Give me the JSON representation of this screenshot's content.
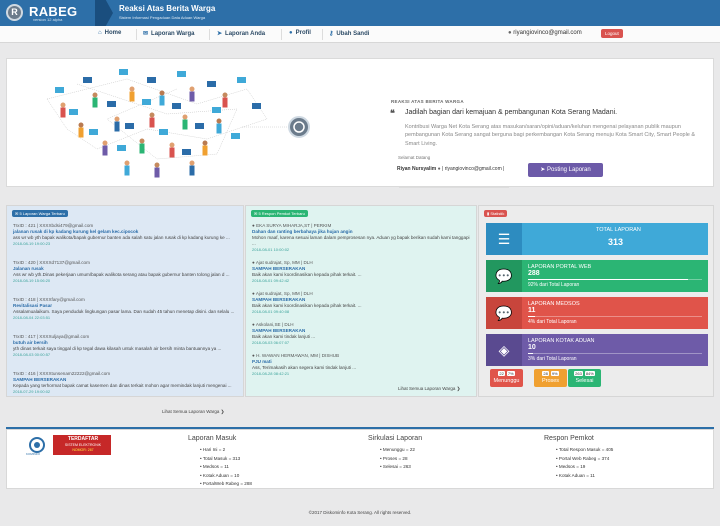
{
  "header": {
    "logo_letter": "R",
    "logo_text": "RABEG",
    "logo_sub": "version 12 alpha",
    "app_title": "Reaksi Atas Berita Warga",
    "app_subtitle": "Sistem Informasi Pengaduan Data Aduan Warga",
    "accent_color": "#2d6fa8"
  },
  "nav": {
    "items": [
      {
        "icon": "home-icon",
        "label": "Home"
      },
      {
        "icon": "comments-icon",
        "label": "Laporan Warga"
      },
      {
        "icon": "send-icon",
        "label": "Laporan Anda"
      },
      {
        "icon": "user-icon",
        "label": "Profil"
      },
      {
        "icon": "key-icon",
        "label": "Ubah Sandi"
      }
    ],
    "user_email": "riyangiovinco@gmail.com",
    "logout_label": "Logout"
  },
  "hero": {
    "tag": "REAKSI ATAS BERITA WARGA",
    "quote": "Jadilah bagian dari kemajuan & pembangunan Kota Serang Madani.",
    "description": "Kontribusi Warga Net Kota Serang atas masukan/saran/opini/aduan/keluhan mengenai pelayanan publik maupun pembangunan Kota Serang sangat berguna bagi perkembangan Kota Serang menuju Kota Smart City, Smart People & Smart Living.",
    "welcome": "Selamat Datang",
    "user_name": "Riyan Nursyalim",
    "user_email_line": "| riyangiovinco@gmail.com |",
    "post_button": "Posting Laporan"
  },
  "panel_warga": {
    "label": "5 Laporan Warga Terbaru",
    "items": [
      {
        "head": "TrxID : 421 | XXXXbdsi479@gmail.com",
        "title": "jalanan rusak di kp kadang kurung kel gelam kec.cipocok",
        "body": "ass wr wb yth bapak walikota/bapak gubernur banten ada salah satu jalan rusak di kp kadang kurung ke ...",
        "date": "2018-08-19 19:00:23"
      },
      {
        "head": "TrxID : 420 | XXXXd7137@gmail.com",
        "title": "Jalanan rusak",
        "body": "Ass wr wb yth.Dinas pekerjaan umum/bapak walikota serang atau bapak gubernur banten tolong jalan d ...",
        "date": "2018-08-19 15:06:20"
      },
      {
        "head": "TrxID : 418 | XXXXfary@gmail.com",
        "title": "Revitalisasi Pasar",
        "body": "Assalamualaikum. Saya penduduk lingkungan pasar lama. Dan sudah 45 tahun menetap disini. dan selalu ...",
        "date": "2018-08-04 22:03:51"
      },
      {
        "head": "TrxID : 417 | XXXXuljaya@gmail.com",
        "title": "butuh air bersih",
        "body": "yth dinas terkait saya tinggal di kp tegal dawa kilasah untuk masalah air bersih minta bantuannya ya ...",
        "date": "2018-08-03 00:00:57"
      },
      {
        "head": "TrxID : 416 | XXXXtunsenam22222@gmail.com",
        "title": "SAMPAH BERSERAKAN",
        "body": "Kepada yang terhormat bapak camat kasemen dan dinas terkait mohon agar memindak lanjuti mengenai ...",
        "date": "2018-07-29 19:00:02"
      }
    ],
    "more": "Lihat Semua Laporan Warga"
  },
  "panel_respon": {
    "label": "5 Respon Pemkot Terbaru",
    "items": [
      {
        "head": "EKA SURYA MIHARJA,ST | PERKIM",
        "title": "Dahan dan ranting berbahaya jika hujan angin",
        "body": "Mohon maaf, karena sesuai laman dalam pemprosesan nya. Aduan yg bapak berikan sudah kami tanggapi ...",
        "date": "2018-08-01 10:00:02"
      },
      {
        "head": "Ajat sudrajat, Sp, MM | DLH",
        "title": "SAMPAH BERSERAKAN",
        "body": "Baik akan kami koordinasikan kepada pihak terkait. ...",
        "date": "2018-08-01 09:42:42"
      },
      {
        "head": "Ajat sudrajat, Sp, MM | DLH",
        "title": "SAMPAH BERSERAKAN",
        "body": "Baik akan kami koordinasikan kepada pihak terkait. ...",
        "date": "2018-08-01 09:40:08"
      },
      {
        "head": "Askolani,SE | DLH",
        "title": "SAMPAH BERSERAKAN",
        "body": "Baik akan kami tindak lanjuti ...",
        "date": "2018-08-03 06:07:07"
      },
      {
        "head": "H. WAWAN HERMAWAN, MM | DISHUB",
        "title": "PJU mati",
        "body": "Ass, Terimakasih akan segera kami tindak lanjuti ...",
        "date": "2018-08-28 08:42:21"
      }
    ],
    "more": "Lihat Semua Laporan Warga"
  },
  "panel_statistik": {
    "label": "Statistik",
    "boxes": [
      {
        "icon": "list-icon",
        "label": "TOTAL LAPORAN",
        "value": "313",
        "foot": "",
        "color": "#3fa9d8",
        "icon_color": "#2d8cc0",
        "fraction": 1
      },
      {
        "icon": "chat-icon",
        "label": "LAPORAN PORTAL WEB",
        "value": "288",
        "foot": "92% dari Total Laporan",
        "color": "#2bb574",
        "icon_color": "#22975f",
        "fraction": 0.92
      },
      {
        "icon": "comments-icon",
        "label": "LAPORAN MEDSOS",
        "value": "11",
        "foot": "4% dari Total Laporan",
        "color": "#e0544a",
        "icon_color": "#c8453c",
        "fraction": 0.04
      },
      {
        "icon": "dropbox-icon",
        "label": "LAPORAN KOTAK ADUAN",
        "value": "10",
        "foot": "3% dari Total Laporan",
        "color": "#6e5ba8",
        "icon_color": "#5a4a90",
        "fraction": 0.03
      }
    ],
    "mini": [
      {
        "count": "22",
        "pct": "7%",
        "label": "Menunggu",
        "color": "#e0544a"
      },
      {
        "count": "28",
        "pct": "9%",
        "label": "Proses",
        "color": "#f0a030"
      },
      {
        "count": "263",
        "pct": "84%",
        "label": "Selesai",
        "color": "#2bb574"
      }
    ]
  },
  "footer": {
    "badge_title": "TERDAFTAR",
    "badge_sub": "SISTEM ELEKTRONIK",
    "badge_nomor": "NOMOR: 267",
    "badge_org": "KOMINFO",
    "col1": {
      "title": "Laporan Masuk",
      "items": [
        "Hari Ini = 2",
        "Total Masuk = 313",
        "Medsos = 11",
        "Kotak Aduan = 10",
        "PortalWeb Rabeg = 288"
      ]
    },
    "col2": {
      "title": "Sirkulasi Laporan",
      "items": [
        "Menunggu = 22",
        "Proses = 28",
        "Selesai = 263"
      ]
    },
    "col3": {
      "title": "Respon Pemkot",
      "items": [
        "Total Respon Masuk = 405",
        "Portal Web Rabeg = 374",
        "Medsos = 19",
        "Kotak Aduan = 11"
      ]
    },
    "copyright": "©2017 Diskominfo Kota Serang. All rights reserved."
  }
}
